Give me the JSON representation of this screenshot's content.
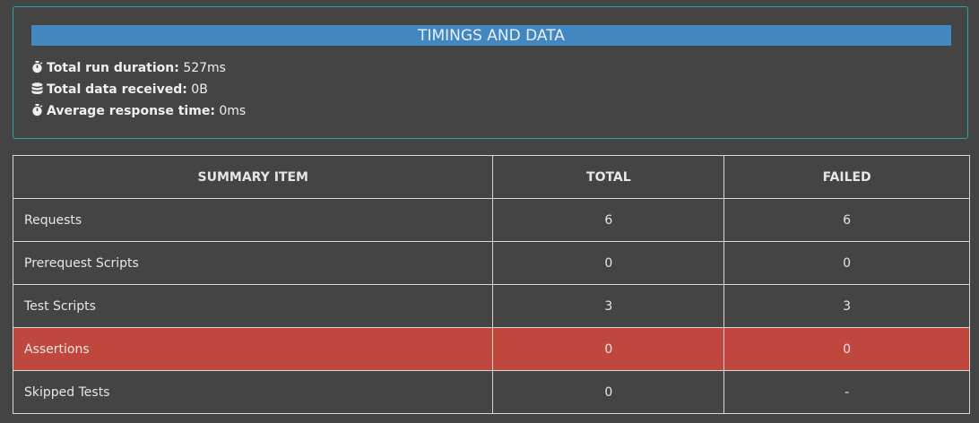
{
  "timings": {
    "title": "TIMINGS AND DATA",
    "stats": [
      {
        "icon": "stopwatch-icon",
        "label": "Total run duration:",
        "value": "527ms"
      },
      {
        "icon": "database-icon",
        "label": "Total data received:",
        "value": "0B"
      },
      {
        "icon": "stopwatch-icon",
        "label": "Average response time:",
        "value": "0ms"
      }
    ]
  },
  "summary": {
    "headers": {
      "item": "SUMMARY ITEM",
      "total": "TOTAL",
      "failed": "FAILED"
    },
    "rows": [
      {
        "item": "Requests",
        "total": "6",
        "failed": "6"
      },
      {
        "item": "Prerequest Scripts",
        "total": "0",
        "failed": "0"
      },
      {
        "item": "Test Scripts",
        "total": "3",
        "failed": "3"
      },
      {
        "item": "Assertions",
        "total": "0",
        "failed": "0"
      },
      {
        "item": "Skipped Tests",
        "total": "0",
        "failed": "-"
      }
    ]
  },
  "colors": {
    "background": "#444444",
    "banner": "#4387c0",
    "card_border": "#2aa3a8",
    "highlight_row": "#c0473e"
  }
}
